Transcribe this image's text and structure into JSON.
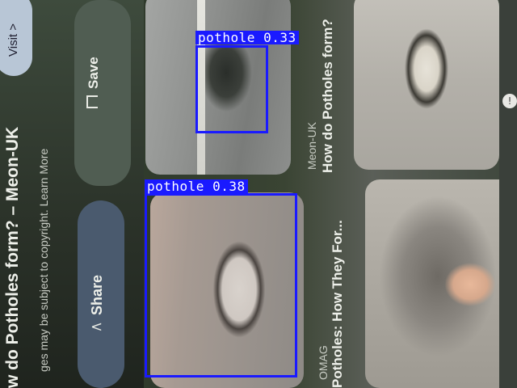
{
  "screen": {
    "visit_button": "Visit >",
    "save_button": "Save",
    "share_button": "Share",
    "title_left": "w do Potholes form? – Meon-UK",
    "copyright": "ges may be subject to copyright. Learn More",
    "card1": {
      "source": "Meon-UK",
      "title": "How do Potholes form?"
    },
    "card2": {
      "source": "OMAG",
      "title": "Potholes: How They For..."
    }
  },
  "detections": [
    {
      "label": "pothole",
      "score": "0.33"
    },
    {
      "label": "pothole",
      "score": "0.38"
    }
  ],
  "colors": {
    "box": "#1a1aff",
    "label_text": "#ffffff"
  }
}
